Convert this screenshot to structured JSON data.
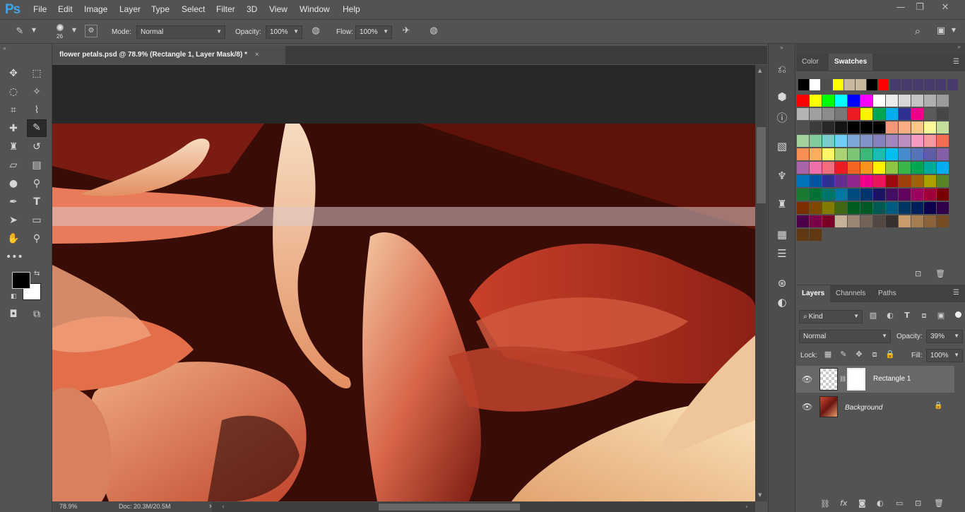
{
  "app": {
    "logo": "Ps"
  },
  "menu": [
    "File",
    "Edit",
    "Image",
    "Layer",
    "Type",
    "Select",
    "Filter",
    "3D",
    "View",
    "Window",
    "Help"
  ],
  "options": {
    "brush_size": "26",
    "mode_label": "Mode:",
    "mode_value": "Normal",
    "opacity_label": "Opacity:",
    "opacity_value": "100%",
    "flow_label": "Flow:",
    "flow_value": "100%"
  },
  "document": {
    "tab_title": "flower petals.psd @ 78.9% (Rectangle 1, Layer Mask/8) *",
    "close": "×"
  },
  "status": {
    "zoom": "78.9%",
    "doc_size": "Doc: 20.3M/20.5M",
    "arrow": "›"
  },
  "color_panel": {
    "tabs": [
      "Color",
      "Swatches"
    ],
    "active": "Swatches"
  },
  "swatches": {
    "row0": [
      "#000000",
      "#ffffff",
      "#4e4e4e",
      "#ffff00",
      "#c8b99c",
      "#c8b99c",
      "#000000",
      "#ff0000",
      "#4a3b6e",
      "#4a3b6e",
      "#4a3b6e",
      "#4a3b6e",
      "#4a3b6e",
      "#4a3b6e"
    ],
    "grid": [
      [
        "#ff0000",
        "#ffff00",
        "#00ff00",
        "#00ffff",
        "#0000ff",
        "#ff00ff",
        "#ffffff",
        "#ebebeb",
        "#d7d7d7",
        "#c3c3c3",
        "#afafaf",
        "#9b9b9b"
      ],
      [
        "#b4b4b4",
        "#a0a0a0",
        "#8c8c8c",
        "#787878",
        "#ed1c24",
        "#fff200",
        "#00a651",
        "#00aeef",
        "#2e3192",
        "#ec008c",
        "#5a5a5a",
        "#464646"
      ],
      [
        "#505050",
        "#3c3c3c",
        "#282828",
        "#141414",
        "#000000",
        "#000000",
        "#000000",
        "#f7977a",
        "#f9ad81",
        "#fdc68a",
        "#fff79a",
        "#c4df9b"
      ],
      [
        "#a3d39c",
        "#82ca9c",
        "#7accc8",
        "#6dcff6",
        "#7da7d9",
        "#8393ca",
        "#8781bd",
        "#a187be",
        "#bc8dbf",
        "#f49ac2",
        "#f6989d",
        "#f26c4f"
      ],
      [
        "#f68e56",
        "#fbaf5d",
        "#fff568",
        "#acd373",
        "#7cc576",
        "#3bb878",
        "#1cbbb4",
        "#00bff3",
        "#448ccb",
        "#5674b9",
        "#605ca8",
        "#855fa8"
      ],
      [
        "#a864a8",
        "#f06eaa",
        "#f26d7d",
        "#ed1c24",
        "#f26522",
        "#f7941d",
        "#fff200",
        "#8dc63f",
        "#39b54a",
        "#00a651",
        "#00a99d",
        "#00aeef"
      ],
      [
        "#0072bc",
        "#0054a6",
        "#2e3192",
        "#662d91",
        "#92278f",
        "#ec008c",
        "#ed145b",
        "#9e0b0f",
        "#a0410d",
        "#a3620a",
        "#aba000",
        "#598527"
      ],
      [
        "#197b30",
        "#007236",
        "#00746b",
        "#0076a3",
        "#004b80",
        "#003471",
        "#1b1464",
        "#440e62",
        "#630460",
        "#9e005d",
        "#9e0039",
        "#790000"
      ],
      [
        "#7b2e00",
        "#7d4900",
        "#827b00",
        "#406618",
        "#005e20",
        "#005826",
        "#005952",
        "#005b7f",
        "#003663",
        "#002157",
        "#0d004c",
        "#32004b"
      ],
      [
        "#4b0049",
        "#7b0046",
        "#7a0026",
        "#c7b299",
        "#998675",
        "#736357",
        "#534741",
        "#37302d",
        "#c69c6d",
        "#a67c52",
        "#8c6239",
        "#754c24"
      ],
      [
        "#603913",
        "#603913"
      ]
    ]
  },
  "layers_panel": {
    "tabs": [
      "Layers",
      "Channels",
      "Paths"
    ],
    "active": "Layers",
    "filter_kind": "Kind",
    "blend_mode": "Normal",
    "opacity_label": "Opacity:",
    "opacity_value": "39%",
    "lock_label": "Lock:",
    "fill_label": "Fill:",
    "fill_value": "100%",
    "layers": [
      {
        "name": "Rectangle 1",
        "visible": true,
        "selected": true
      },
      {
        "name": "Background",
        "visible": true,
        "locked": true
      }
    ]
  }
}
